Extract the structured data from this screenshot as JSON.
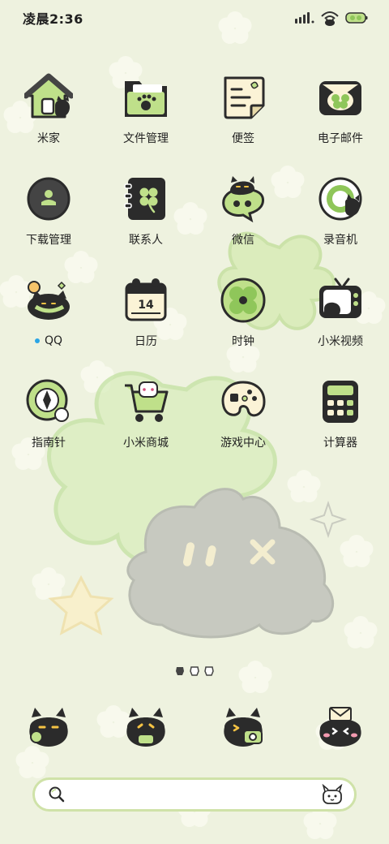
{
  "status_bar": {
    "time": "凌晨2:36",
    "icons": [
      "signal-bars-icon",
      "cat-wifi-icon",
      "clover-battery-icon"
    ]
  },
  "apps": [
    {
      "label": "米家",
      "icon": "house-cat-icon"
    },
    {
      "label": "文件管理",
      "icon": "folder-paw-icon"
    },
    {
      "label": "便签",
      "icon": "notepad-icon"
    },
    {
      "label": "电子邮件",
      "icon": "mail-clover-icon"
    },
    {
      "label": "下载管理",
      "icon": "download-circle-icon"
    },
    {
      "label": "联系人",
      "icon": "contacts-book-icon"
    },
    {
      "label": "微信",
      "icon": "wechat-cat-icon"
    },
    {
      "label": "录音机",
      "icon": "recorder-icon"
    },
    {
      "label": "QQ",
      "icon": "qq-cat-icon",
      "new_indicator": true
    },
    {
      "label": "日历",
      "icon": "calendar-icon",
      "day": "14"
    },
    {
      "label": "时钟",
      "icon": "clover-clock-icon"
    },
    {
      "label": "小米视频",
      "icon": "tv-cat-icon"
    },
    {
      "label": "指南针",
      "icon": "compass-icon"
    },
    {
      "label": "小米商城",
      "icon": "shopping-cart-icon"
    },
    {
      "label": "游戏中心",
      "icon": "game-palette-icon"
    },
    {
      "label": "计算器",
      "icon": "calculator-icon"
    }
  ],
  "page_indicator": {
    "pages": 3,
    "current": 1
  },
  "dock": [
    {
      "icon": "phone-cat-icon"
    },
    {
      "icon": "message-cat-icon"
    },
    {
      "icon": "camera-cat-icon"
    },
    {
      "icon": "browser-cat-icon"
    }
  ],
  "search_bar": {
    "placeholder": "",
    "mascot_icon": "xiaoai-mascot-icon"
  },
  "colors": {
    "background": "#eef2df",
    "icon_green": "#bfe08a",
    "icon_dark": "#2b2b2b",
    "icon_cream": "#fbf3d6",
    "accent_blue_dot": "#2aa5e6"
  }
}
